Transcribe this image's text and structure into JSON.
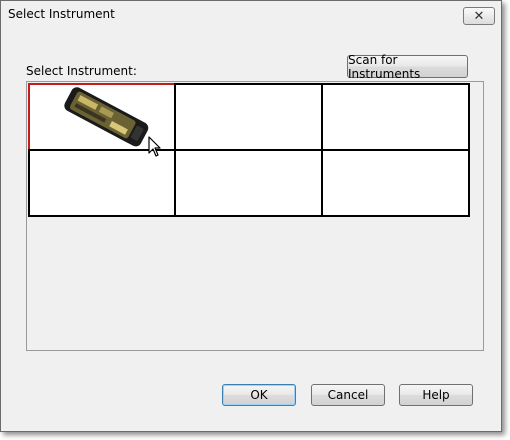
{
  "window": {
    "title": "Select Instrument",
    "close_glyph": "✕"
  },
  "labels": {
    "select_instrument": "Select Instrument:"
  },
  "buttons": {
    "scan": "Scan for Instruments",
    "ok": "OK",
    "cancel": "Cancel",
    "help": "Help"
  },
  "grid": {
    "cells": [
      {
        "icon": "instrument-device-icon",
        "selected": true
      },
      {
        "icon": "",
        "selected": false
      },
      {
        "icon": "",
        "selected": false
      },
      {
        "icon": "",
        "selected": false
      },
      {
        "icon": "",
        "selected": false
      },
      {
        "icon": "",
        "selected": false
      }
    ]
  },
  "colors": {
    "selection_border": "#c41b1b",
    "window_bg": "#f0f0f0"
  }
}
